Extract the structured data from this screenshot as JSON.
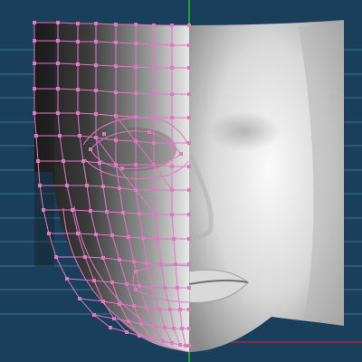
{
  "viewport": {
    "background_color": "#1a3f5a",
    "grid_line_color": "#44708c",
    "y_axis_color": "#26c01f",
    "x_axis_color": "#9a2a44"
  },
  "model": {
    "mesh_wire_color": "#e07ac0",
    "mesh_vertex_color": "#e07ac0",
    "mirrored_side": "left",
    "smooth_side": "right"
  }
}
